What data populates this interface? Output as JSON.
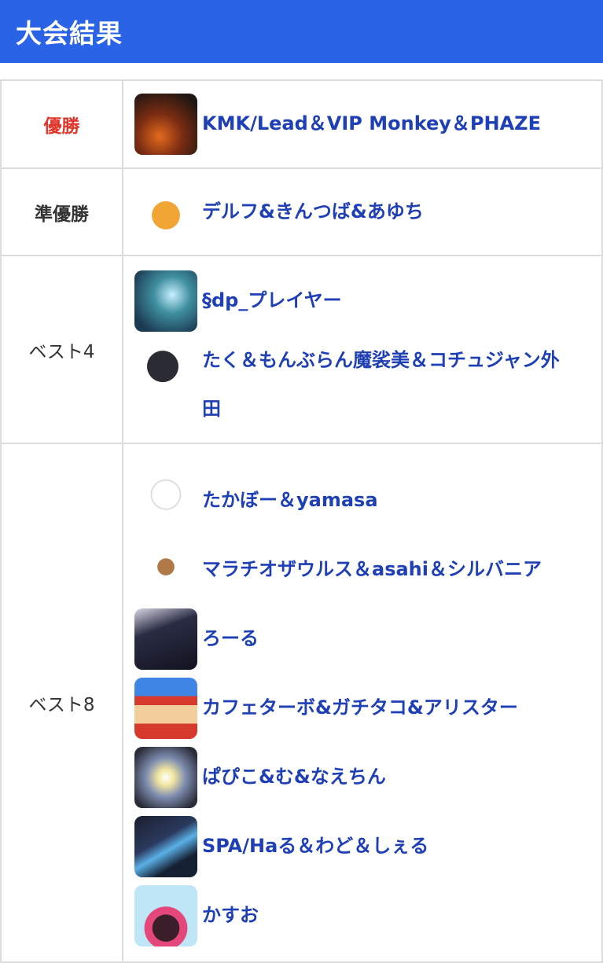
{
  "header": {
    "title": "大会結果"
  },
  "results": [
    {
      "rank": "優勝",
      "teams": [
        {
          "name": "KMK/Lead＆VIP Monkey＆PHAZE",
          "icon": "fire-avatar-icon"
        }
      ]
    },
    {
      "rank": "準優勝",
      "teams": [
        {
          "name": "デルフ&きんつば&あゆち",
          "icon": "cookie-avatar-icon"
        }
      ]
    },
    {
      "rank": "ベスト4",
      "teams": [
        {
          "name": "§dp_プレイヤー",
          "icon": "luigi-avatar-icon"
        },
        {
          "name": "たく＆もんぶらん魔裟美＆コチュジャン外田",
          "icon": "cat-avatar-icon"
        }
      ]
    },
    {
      "rank": "ベスト8",
      "teams": [
        {
          "name": "たかぼー＆yamasa",
          "icon": "sketch-avatar-icon"
        },
        {
          "name": "マラチオザウルス＆asahi＆シルバニア",
          "icon": "monkey-avatar-icon"
        },
        {
          "name": "ろーる",
          "icon": "dark-character-avatar-icon"
        },
        {
          "name": "カフェターボ&ガチタコ&アリスター",
          "icon": "mario-avatar-icon"
        },
        {
          "name": "ぱぴこ&む&なえちん",
          "icon": "orb-avatar-icon"
        },
        {
          "name": "SPA/Haる＆わど＆しぇる",
          "icon": "blue-blade-avatar-icon"
        },
        {
          "name": "かすお",
          "icon": "pink-creature-avatar-icon"
        }
      ]
    }
  ],
  "colors": {
    "header_bg": "#2b63e6",
    "winner_rank": "#e2352b",
    "team_link": "#1f3fb5"
  }
}
